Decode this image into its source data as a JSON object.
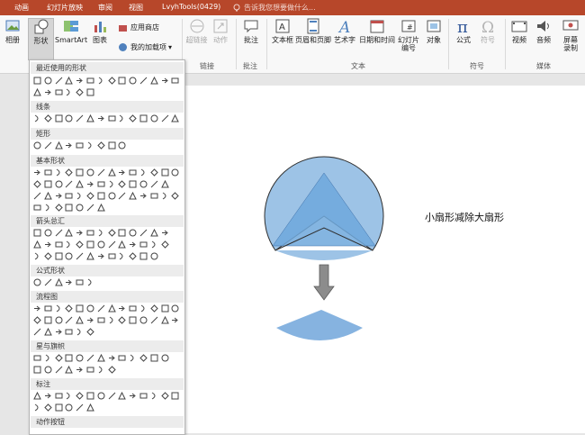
{
  "tabs": [
    "动画",
    "幻灯片放映",
    "审阅",
    "视图",
    "LvyhTools(0429)"
  ],
  "tell_me": "告诉我您想要做什么...",
  "ribbon": {
    "album": "相册",
    "shapes": "形状",
    "smartart": "SmartArt",
    "chart": "图表",
    "store": "应用商店",
    "my_addins": "我的加载项",
    "hyperlink": "超链接",
    "action": "动作",
    "comment": "批注",
    "textbox": "文本框",
    "header_footer": "页眉和页脚",
    "wordart": "艺术字",
    "datetime": "日期和时间",
    "slide_number_l1": "幻灯片",
    "slide_number_l2": "编号",
    "object": "对象",
    "equation": "公式",
    "symbol": "符号",
    "video": "视频",
    "audio": "音频",
    "screen_l1": "屏幕",
    "screen_l2": "录制",
    "groups": {
      "links": "链接",
      "comments": "批注",
      "text": "文本",
      "symbols": "符号",
      "media": "媒体"
    }
  },
  "shapes_panel": {
    "categories": [
      "最近使用的形状",
      "线条",
      "矩形",
      "基本形状",
      "箭头总汇",
      "公式形状",
      "流程图",
      "星与旗帜",
      "标注",
      "动作按钮"
    ]
  },
  "slide": {
    "caption": "小扇形减除大扇形"
  },
  "colors": {
    "accent": "#b7472a",
    "sector_fill": "#9dc3e6",
    "triangle_fill": "#6fa8dc",
    "sector_stroke": "#2f2f2f",
    "arrow": "#8c8c8c",
    "result_fill": "#86b3e0"
  }
}
